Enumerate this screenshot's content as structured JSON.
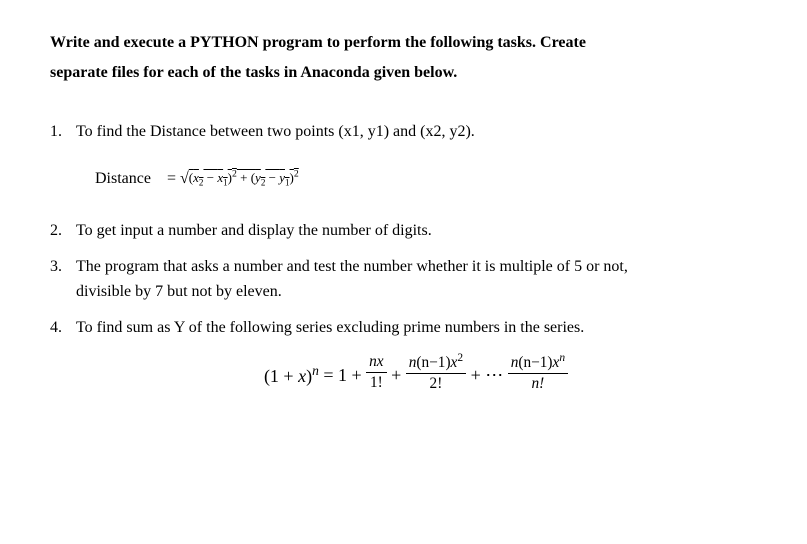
{
  "header": {
    "line1": "Write and execute a PYTHON program to perform the following tasks.  Create",
    "line2": "separate files for each of the tasks in Anaconda  given below."
  },
  "items": {
    "n1": "1.",
    "t1": "To find the Distance between two points (x1, y1) and (x2, y2).",
    "n2": "2.",
    "t2": "To get input a number and display the number of digits.",
    "n3": "3.",
    "t3": "The program that asks a number and test the number whether it is multiple of 5 or not,",
    "t3b": "divisible by 7 but not by eleven.",
    "n4": "4.",
    "t4": "To find sum as Y of the following series excluding prime numbers in the series."
  },
  "formula1": {
    "label": "Distance",
    "eq": "=",
    "x2": "x",
    "s2": "2",
    "minus": " − ",
    "x1": "x",
    "s1": "1",
    "sq": "2",
    "plus": " + (",
    "y2": "y",
    "ys2": "2",
    "y1": "y",
    "ys1": "1",
    "close": ")"
  },
  "formula2": {
    "lhs_base": "(1 + ",
    "lhs_x": "x",
    "lhs_close": ")",
    "lhs_exp": "n",
    "eq": " = 1 + ",
    "t1_top": "nx",
    "t1_bot": "1!",
    "plus1": " + ",
    "t2_top_a": "n",
    "t2_top_b": "(n−1)",
    "t2_top_c": "x",
    "t2_top_exp": "2",
    "t2_bot": "2!",
    "plus2": " + ⋯ ",
    "tn_top_a": "n",
    "tn_top_b": "(n−1)",
    "tn_top_c": "x",
    "tn_top_exp": "n",
    "tn_bot": "n!"
  }
}
